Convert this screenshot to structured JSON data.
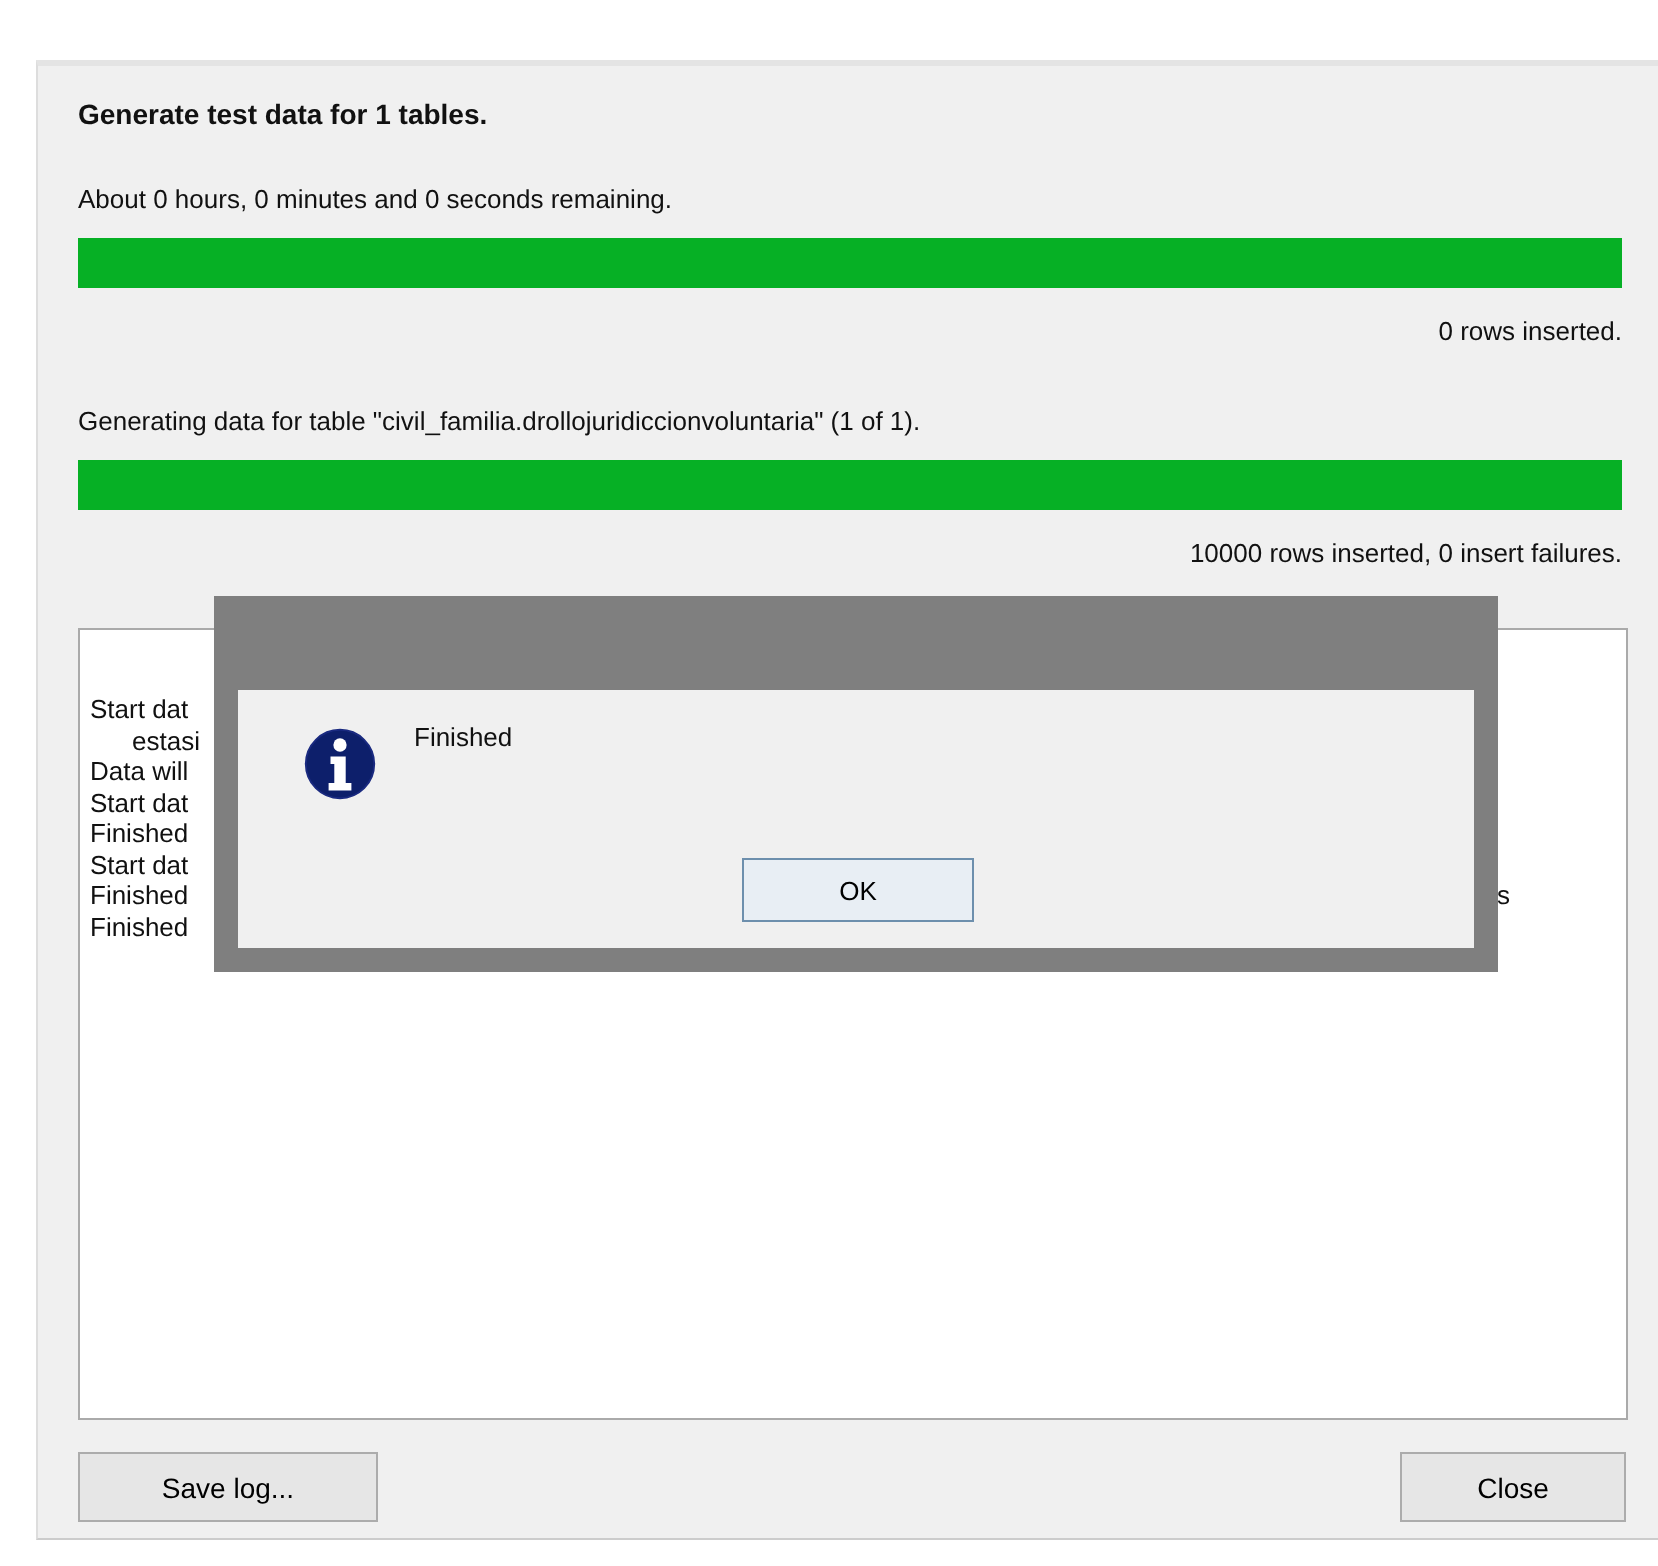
{
  "heading": "Generate test data for 1 tables.",
  "overall": {
    "label": "About 0 hours, 0 minutes and 0 seconds remaining.",
    "level": 1,
    "reading": "0 rows inserted."
  },
  "table": {
    "label": "Generating data for table \"civil_familia.drollojuridiccionvoluntaria\" (1 of 1).",
    "level": 1,
    "reading": "10000 rows inserted, 0 insert failures."
  },
  "log": [
    {
      "text": "Start dat",
      "indent": false
    },
    {
      "text": "estasi",
      "indent": true
    },
    {
      "text": "Data will",
      "indent": false
    },
    {
      "text": "Start dat",
      "indent": false
    },
    {
      "text": "Finished",
      "indent": false
    },
    {
      "text": "Start dat",
      "indent": false
    },
    {
      "text": "Finished",
      "indent": false,
      "tail": "s"
    },
    {
      "text": "Finished",
      "indent": false
    }
  ],
  "dialog": {
    "message": "Finished",
    "button": "OK"
  },
  "buttons": {
    "save": "Save log...",
    "close": "Close"
  }
}
